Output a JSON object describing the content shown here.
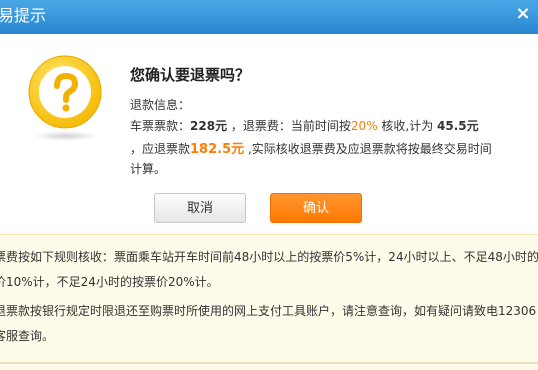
{
  "dialog": {
    "title": "易提示",
    "close_symbol": "×",
    "icon": "question-mark-icon",
    "colors": {
      "titlebar": "#2a86d1",
      "accent": "#ff7d00",
      "notes_bg": "#fffbea"
    }
  },
  "message": {
    "question": "您确认要退票吗？",
    "info_label": "退款信息：",
    "ticket_price_label": "车票票款：",
    "ticket_price": "228元",
    "refund_fee_label": "，退票费：当前时间按",
    "fee_rate": "20%",
    "fee_rate_suffix": " 核收,计为 ",
    "refund_fee": "45.5元",
    "refund_label": "，应退票款",
    "refund_amount": "182.5元",
    "refund_note_1": " ,实际核收退票费及应退票款将按最终交易时间",
    "refund_note_2": "计算。"
  },
  "buttons": {
    "cancel": "取消",
    "confirm": "确认"
  },
  "notes": [
    "票费按如下规则核收：票面乘车站开车时间前48小时以上的按票价5%计，24小时以上、不足48小时的",
    "价10%计，不足24小时的按票价20%计。",
    "退票款按银行规定时限退还至购票时所使用的网上支付工具账户，请注意查询，如有疑问请致电12306",
    "客服查询。"
  ]
}
